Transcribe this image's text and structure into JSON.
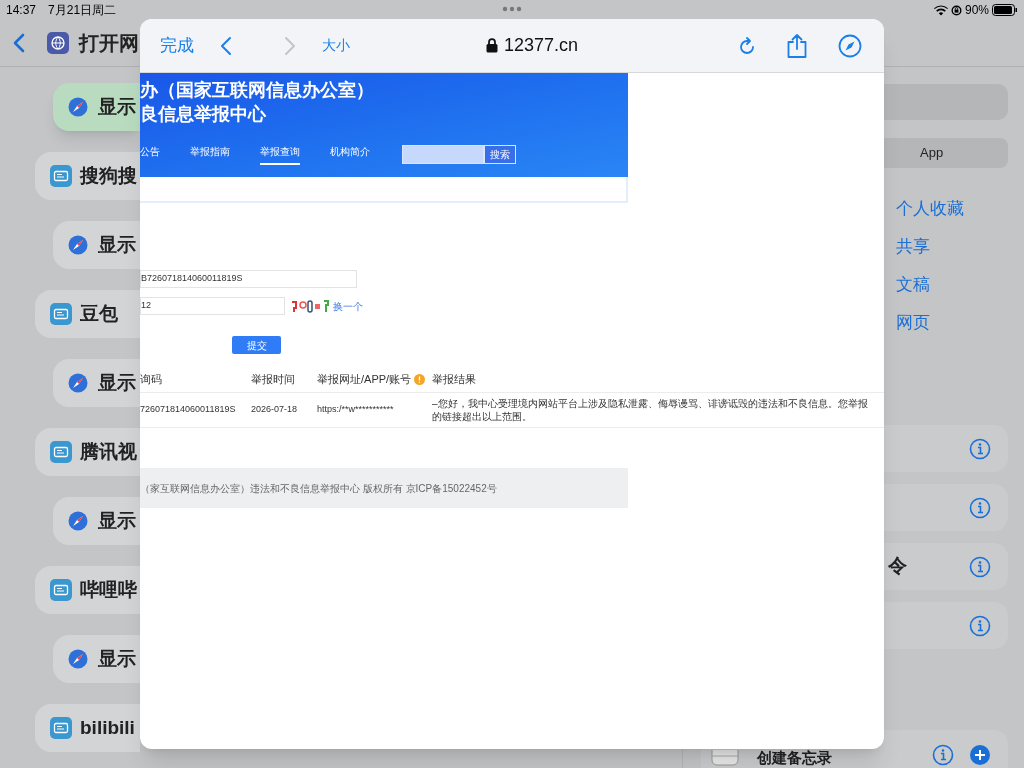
{
  "status_bar": {
    "time": "14:37",
    "date": "7月21日周二",
    "battery_text": "90%"
  },
  "left_pane": {
    "title": "打开网",
    "items": [
      {
        "kind": "action",
        "label": "显示",
        "selected": true
      },
      {
        "kind": "app",
        "label": "搜狗搜",
        "selected": false
      },
      {
        "kind": "action",
        "label": "显示",
        "selected": false
      },
      {
        "kind": "app",
        "label": "豆包",
        "selected": false
      },
      {
        "kind": "action",
        "label": "显示",
        "selected": false
      },
      {
        "kind": "app",
        "label": "腾讯视",
        "selected": false
      },
      {
        "kind": "action",
        "label": "显示",
        "selected": false
      },
      {
        "kind": "app",
        "label": "哔哩哔",
        "selected": false
      },
      {
        "kind": "action",
        "label": "显示",
        "selected": false
      },
      {
        "kind": "app",
        "label": "bilibili",
        "selected": false
      }
    ]
  },
  "right_pane": {
    "segment": "App",
    "locations": [
      "个人收藏",
      "共享",
      "文稿",
      "网页"
    ],
    "rows": [
      {
        "kind": "blank"
      },
      {
        "kind": "blank"
      },
      {
        "kind": "label",
        "label": "令"
      },
      {
        "kind": "blank"
      }
    ],
    "bottom_row": {
      "label": "创建备忘录"
    }
  },
  "browser": {
    "done": "完成",
    "back_enabled": true,
    "forward_enabled": false,
    "text_size": "大小",
    "url": "12377.cn",
    "page": {
      "banner_lines": [
        "办（国家互联网信息办公室）",
        "良信息举报中心"
      ],
      "nav": [
        {
          "label": "公告",
          "selected": false
        },
        {
          "label": "举报指南",
          "selected": false
        },
        {
          "label": "举报查询",
          "selected": true
        },
        {
          "label": "机构简介",
          "selected": false
        }
      ],
      "search_button": "搜索",
      "query_code_value": "B726071814060011819S",
      "captcha_value": "12",
      "captcha_refresh": "换一个",
      "submit": "提交",
      "table": {
        "columns": [
          "询码",
          "举报时间",
          "举报网址/APP/账号",
          "举报结果"
        ],
        "rows": [
          [
            "726071814060011819S",
            "2026-07-18",
            "https:/**w***********",
            "–您好，我中心受理境内网站平台上涉及隐私泄露、侮辱谩骂、诽谤诋毁的违法和不良信息。您举报的链接超出以上范围。"
          ]
        ]
      },
      "footer": "（家互联网信息办公室）违法和不良信息举报中心 版权所有 京ICP备15022452号"
    }
  }
}
